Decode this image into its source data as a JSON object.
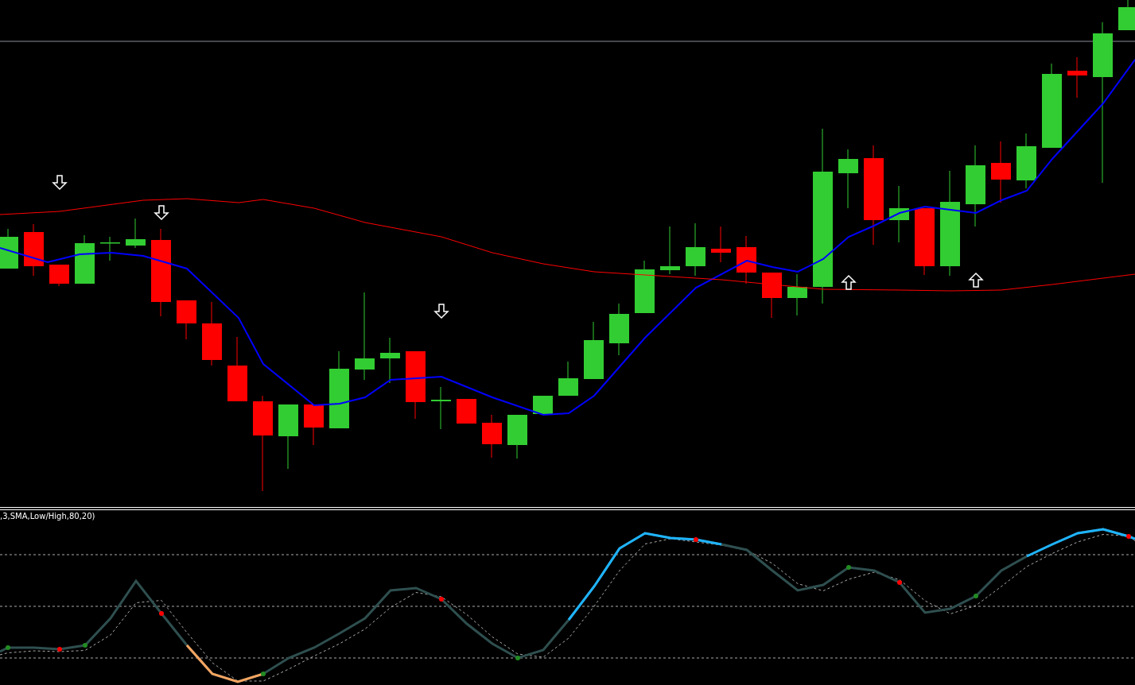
{
  "indicator_window": {
    "label": ",3,SMA,Low/High,80,20)"
  }
}
